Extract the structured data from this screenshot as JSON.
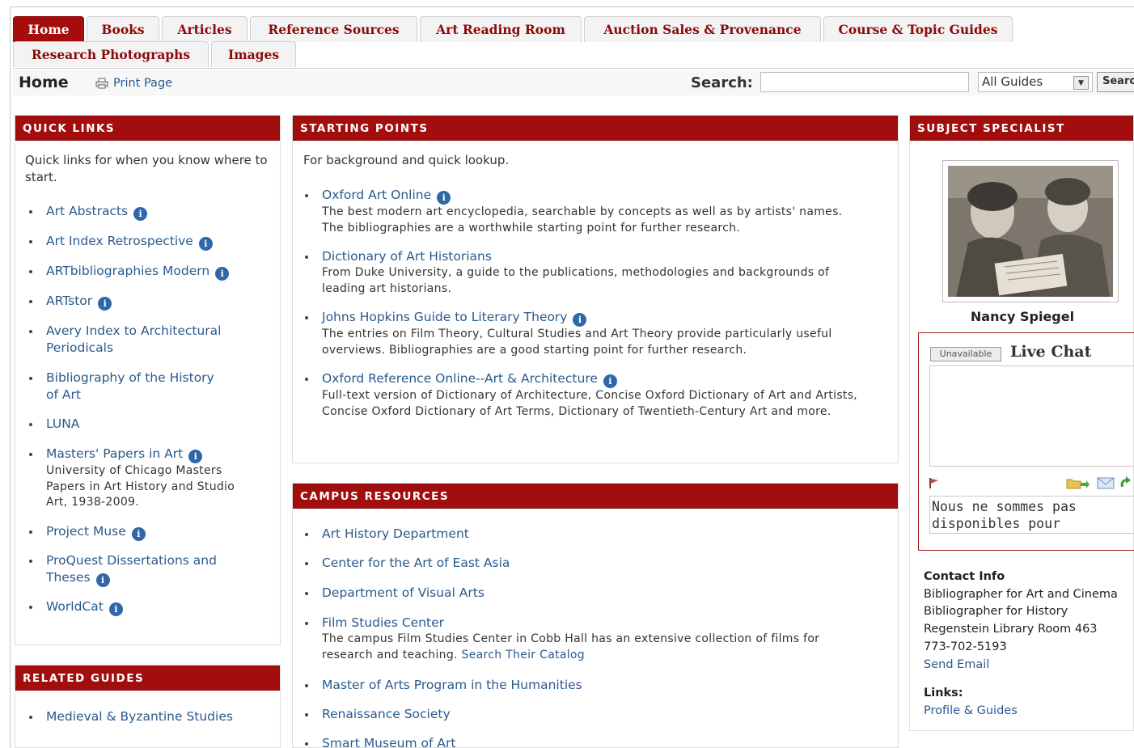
{
  "tabs_row1": [
    "Home",
    "Books",
    "Articles",
    "Reference Sources",
    "Art Reading Room",
    "Auction Sales & Provenance",
    "Course & Topic Guides"
  ],
  "tabs_row2": [
    "Research Photographs",
    "Images"
  ],
  "subheader": {
    "home": "Home",
    "print": "Print Page",
    "search_label": "Search:",
    "search_value": "",
    "select_value": "All Guides",
    "search_button": "Search"
  },
  "quick_links": {
    "title": "QUICK LINKS",
    "intro": "Quick links for when you know where to start.",
    "items": [
      {
        "label": "Art Abstracts",
        "info": true
      },
      {
        "label": "Art Index Retrospective",
        "info": true
      },
      {
        "label": "ARTbibliographies Modern",
        "info": true
      },
      {
        "label": "ARTstor",
        "info": true
      },
      {
        "label": "Avery Index to Architectural Periodicals",
        "info": false
      },
      {
        "label": "Bibliography of the History of Art",
        "info": false
      },
      {
        "label": "LUNA",
        "info": false
      },
      {
        "label": "Masters' Papers in Art",
        "info": true,
        "desc": "University of Chicago Masters Papers in Art History and Studio Art, 1938-2009."
      },
      {
        "label": "Project Muse",
        "info": true
      },
      {
        "label": "ProQuest Dissertations and Theses",
        "info": true
      },
      {
        "label": "WorldCat",
        "info": true
      }
    ]
  },
  "related_guides": {
    "title": "RELATED GUIDES",
    "items": [
      "Medieval & Byzantine Studies"
    ]
  },
  "starting_points": {
    "title": "STARTING POINTS",
    "intro": "For background and quick lookup.",
    "items": [
      {
        "label": "Oxford Art Online",
        "info": true,
        "desc": "The best modern art encyclopedia, searchable by concepts as well as by artists' names. The bibliographies are a worthwhile starting point for further research."
      },
      {
        "label": "Dictionary of Art Historians",
        "info": false,
        "desc": "From Duke University, a guide to the publications, methodologies and backgrounds of leading art historians."
      },
      {
        "label": "Johns Hopkins Guide to Literary Theory",
        "info": true,
        "desc": "The entries on Film Theory, Cultural Studies and Art Theory provide particularly useful overviews. Bibliographies are a good starting point for further research."
      },
      {
        "label": "Oxford Reference Online--Art & Architecture",
        "info": true,
        "desc": "Full-text version of Dictionary of Architecture, Concise Oxford Dictionary of Art and Artists, Concise Oxford Dictionary of Art Terms, Dictionary of Twentieth-Century Art and more."
      }
    ]
  },
  "campus_resources": {
    "title": "CAMPUS RESOURCES",
    "items": [
      {
        "label": "Art History Department"
      },
      {
        "label": "Center for the Art of East Asia"
      },
      {
        "label": "Department of Visual Arts"
      },
      {
        "label": "Film Studies Center",
        "desc": "The campus Film Studies Center in Cobb Hall has an extensive collection of films for research and teaching.",
        "desc_link": "Search Their Catalog"
      },
      {
        "label": "Master of Arts Program in the Humanities"
      },
      {
        "label": "Renaissance Society"
      },
      {
        "label": "Smart Museum of Art"
      }
    ]
  },
  "subject_specialist": {
    "title": "SUBJECT SPECIALIST",
    "name": "Nancy Spiegel",
    "chat_status": "Unavailable",
    "chat_title": "Live Chat",
    "chat_message": "Nous ne sommes pas disponibles pour",
    "contact_heading": "Contact Info",
    "contact_lines": [
      "Bibliographer for Art and Cinema",
      "Bibliographer for History",
      "Regenstein Library Room 463",
      "773-702-5193"
    ],
    "email": "Send Email",
    "links_heading": "Links:",
    "profile_link": "Profile & Guides"
  }
}
